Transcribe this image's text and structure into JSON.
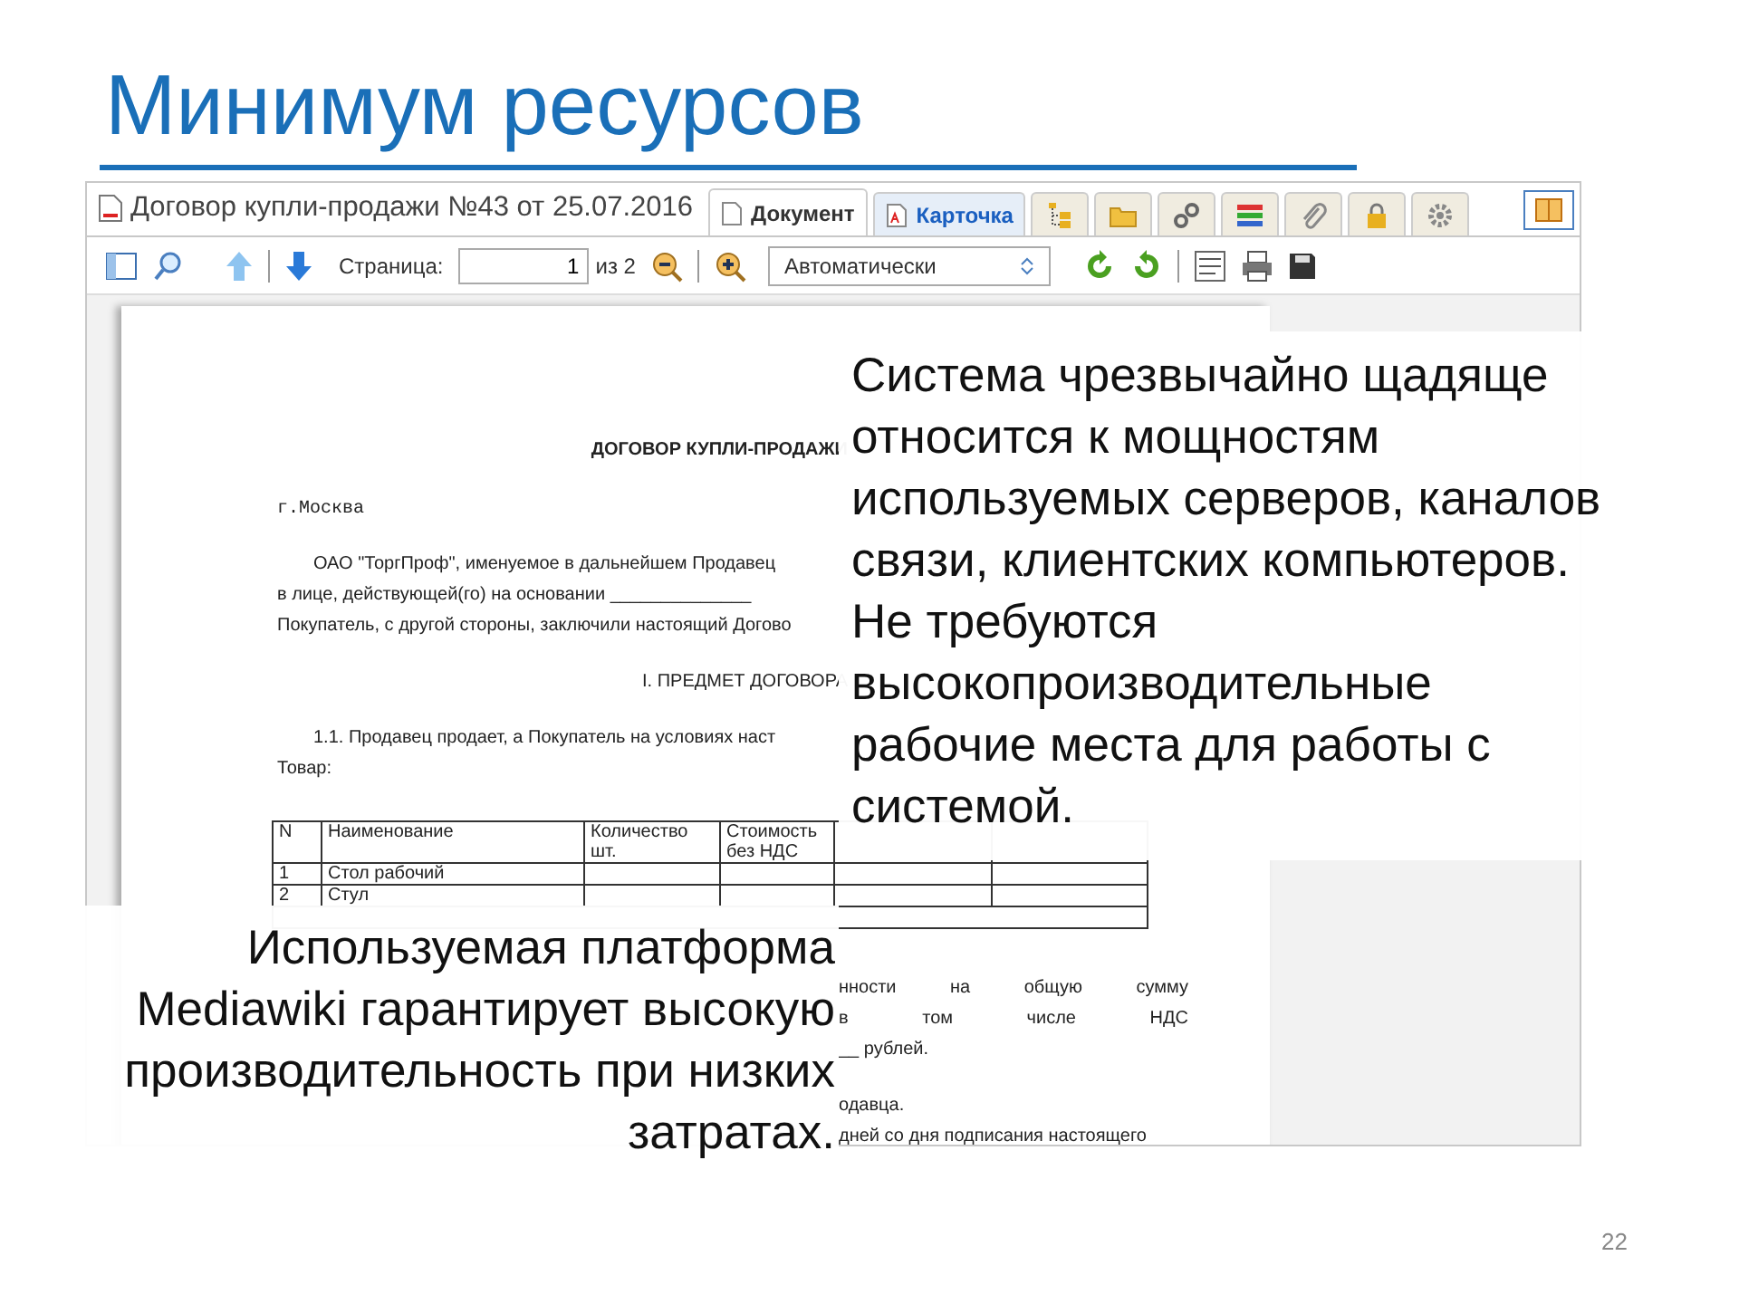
{
  "slide": {
    "title": "Минимум ресурсов",
    "page_number": "22"
  },
  "window": {
    "title": "Договор купли-продажи №43 от 25.07.2016",
    "tabs": [
      {
        "kind": "text",
        "label": "Документ",
        "selected": true
      },
      {
        "kind": "text",
        "label": "Карточка",
        "selected": false
      },
      {
        "kind": "icon",
        "selected": false
      },
      {
        "kind": "icon",
        "selected": false
      },
      {
        "kind": "icon",
        "selected": false
      },
      {
        "kind": "icon",
        "selected": false
      },
      {
        "kind": "icon",
        "selected": false
      },
      {
        "kind": "icon",
        "selected": false
      },
      {
        "kind": "icon",
        "selected": false
      }
    ]
  },
  "toolbar": {
    "page_label": "Страница:",
    "page_value": "1",
    "page_total": "из 2",
    "zoom_value": "Автоматически"
  },
  "document": {
    "heading": "ДОГОВОР КУПЛИ-ПРОДАЖИ",
    "city": "г.Москва",
    "intro": [
      "ОАО \"ТоргПроф\", именуемое в дальнейшем Продавец",
      "в лице, действующей(го) на основании ______________",
      "Покупатель, с другой стороны, заключили настоящий Догово"
    ],
    "section": "I. ПРЕДМЕТ ДОГОВОРА",
    "clause": "1.1. Продавец продает, а Покупатель на условиях наст",
    "goods": "Товар:",
    "table": {
      "columns": [
        "N",
        "Наименование",
        "Количество шт.",
        "Стоимость без НДС"
      ],
      "rows": [
        [
          "1",
          "Стол рабочий"
        ],
        [
          "2",
          "Стул"
        ]
      ]
    },
    "fragments": [
      {
        "text": "нности на общую сумму",
        "kind": "justified"
      },
      {
        "text": "в том числе НДС",
        "kind": "justified"
      },
      {
        "text": "__ рублей.",
        "kind": "plain"
      },
      {
        "kind": "gap"
      },
      {
        "text": "одавца.",
        "kind": "plain"
      },
      {
        "text": "дней со дня подписания настоящего",
        "kind": "plain"
      }
    ]
  },
  "callouts": [
    {
      "kind": "right",
      "text": "Система чрезвычайно щадяще относится к мощностям используемых серверов, каналов связи, клиентских компьютеров. Не требуются высокопроизводительные рабочие места для работы с системой."
    },
    {
      "kind": "left",
      "text": "Используемая платформа Mediawiki гарантирует высокую производительность при низких затратах."
    }
  ]
}
